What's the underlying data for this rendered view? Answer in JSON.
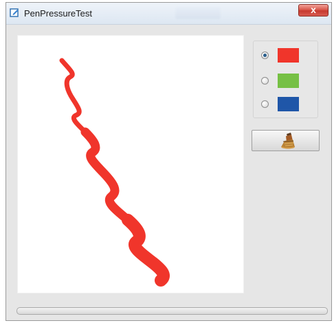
{
  "window": {
    "title": "PenPressureTest",
    "close_symbol": "x"
  },
  "canvas": {
    "stroke_color": "#f0352b",
    "background": "#ffffff"
  },
  "color_options": [
    {
      "name": "red",
      "color": "#f0352b",
      "selected": true
    },
    {
      "name": "green",
      "color": "#76c044",
      "selected": false
    },
    {
      "name": "blue",
      "color": "#1f56a8",
      "selected": false
    }
  ],
  "clear_button": {
    "icon": "broom-icon"
  },
  "icons": {
    "title_icon": "pen-edit-icon"
  }
}
